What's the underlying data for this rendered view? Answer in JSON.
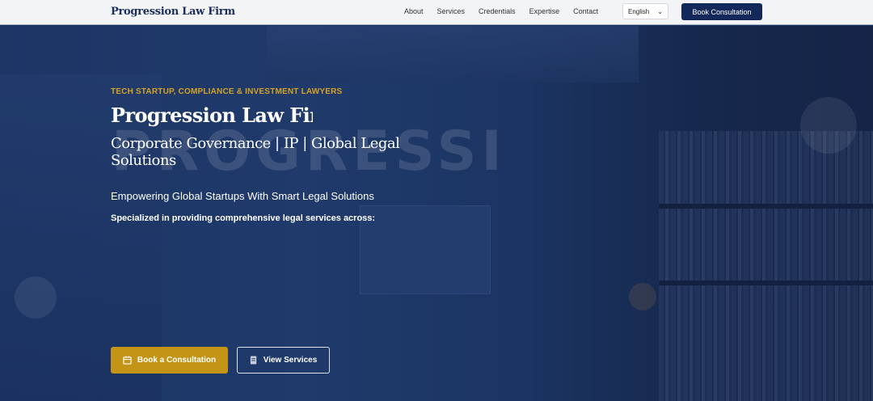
{
  "nav": {
    "logo": "Progression Law Firm",
    "links": [
      "About",
      "Services",
      "Credentials",
      "Expertise",
      "Contact"
    ],
    "language": "English",
    "book_label": "Book Consultation"
  },
  "hero": {
    "watermark": "PROGRESSI",
    "eyebrow": "TECH STARTUP, COMPLIANCE & INVESTMENT LAWYERS",
    "title": "Progression Law Firm",
    "subtitle": "Corporate Governance | IP | Global Legal Solutions",
    "tagline": "Empowering Global Startups With Smart Legal Solutions",
    "specialized": "Specialized in providing comprehensive legal services across:",
    "primary_button": "Book a Consultation",
    "secondary_button": "View Services"
  },
  "colors": {
    "navy": "#13285a",
    "gold": "#c39415"
  }
}
